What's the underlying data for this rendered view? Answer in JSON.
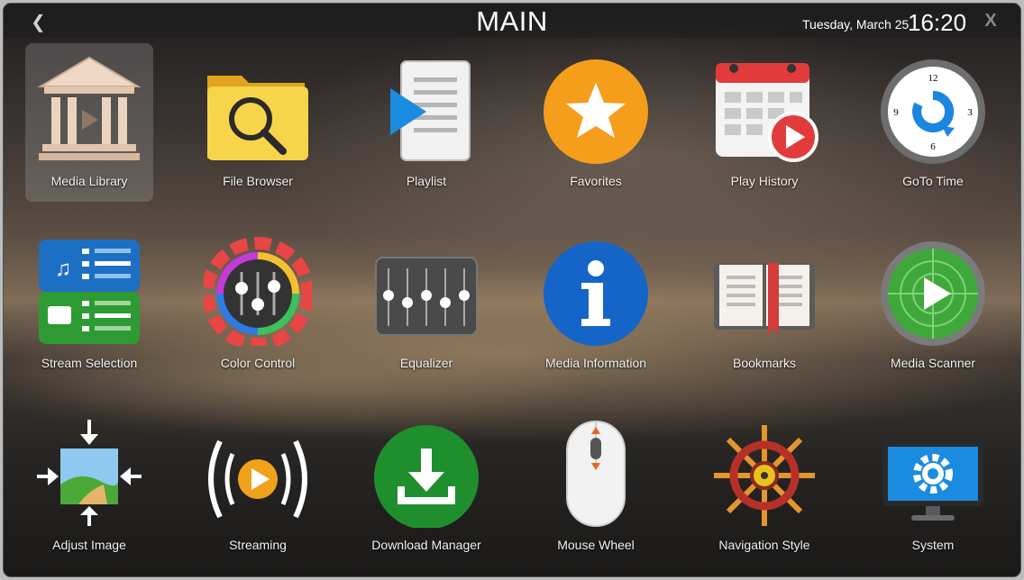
{
  "header": {
    "back_icon": "chevron-left-icon",
    "title": "MAIN",
    "date": "Tuesday, March 25",
    "time": "16:20",
    "close_label": "X"
  },
  "tiles": [
    {
      "label": "Media Library",
      "icon": "library-icon",
      "selected": true
    },
    {
      "label": "File Browser",
      "icon": "folder-search-icon"
    },
    {
      "label": "Playlist",
      "icon": "playlist-icon"
    },
    {
      "label": "Favorites",
      "icon": "star-icon"
    },
    {
      "label": "Play History",
      "icon": "calendar-play-icon"
    },
    {
      "label": "GoTo Time",
      "icon": "clock-icon"
    },
    {
      "label": "Stream Selection",
      "icon": "stream-selection-icon"
    },
    {
      "label": "Color Control",
      "icon": "color-gear-icon"
    },
    {
      "label": "Equalizer",
      "icon": "equalizer-icon"
    },
    {
      "label": "Media Information",
      "icon": "info-icon"
    },
    {
      "label": "Bookmarks",
      "icon": "book-icon"
    },
    {
      "label": "Media Scanner",
      "icon": "radar-icon"
    },
    {
      "label": "Adjust Image",
      "icon": "adjust-image-icon"
    },
    {
      "label": "Streaming",
      "icon": "streaming-icon"
    },
    {
      "label": "Download Manager",
      "icon": "download-icon"
    },
    {
      "label": "Mouse Wheel",
      "icon": "mouse-icon"
    },
    {
      "label": "Navigation Style",
      "icon": "ship-wheel-icon"
    },
    {
      "label": "System",
      "icon": "monitor-gear-icon"
    }
  ],
  "clock_numbers": [
    "12",
    "3",
    "6",
    "9"
  ]
}
